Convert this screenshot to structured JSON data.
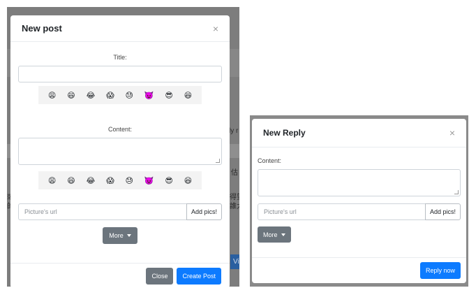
{
  "background_page": {
    "left_fragments": [
      "【",
      "或戶",
      "的"
    ],
    "right_fragments": [
      "ly r",
      "估",
      "得望",
      "誰大"
    ],
    "partial_button": "Vi"
  },
  "new_post_modal": {
    "title": "New post",
    "close_glyph": "×",
    "title_label": "Title:",
    "content_label": "Content:",
    "emojis": [
      "😩",
      "😄",
      "😂",
      "😱",
      "😓",
      "👿",
      "😎",
      "😆"
    ],
    "picture_placeholder": "Picture's url",
    "add_pics_label": "Add pics!",
    "more_label": "More",
    "close_label": "Close",
    "create_label": "Create Post"
  },
  "new_reply_modal": {
    "title": "New Reply",
    "close_glyph": "×",
    "content_label": "Content:",
    "picture_placeholder": "Picture's url",
    "add_pics_label": "Add pics!",
    "more_label": "More",
    "reply_label": "Reply now"
  },
  "colors": {
    "primary": "#0d7bff",
    "secondary": "#6c757d",
    "backdrop": "#7d7d7d"
  }
}
